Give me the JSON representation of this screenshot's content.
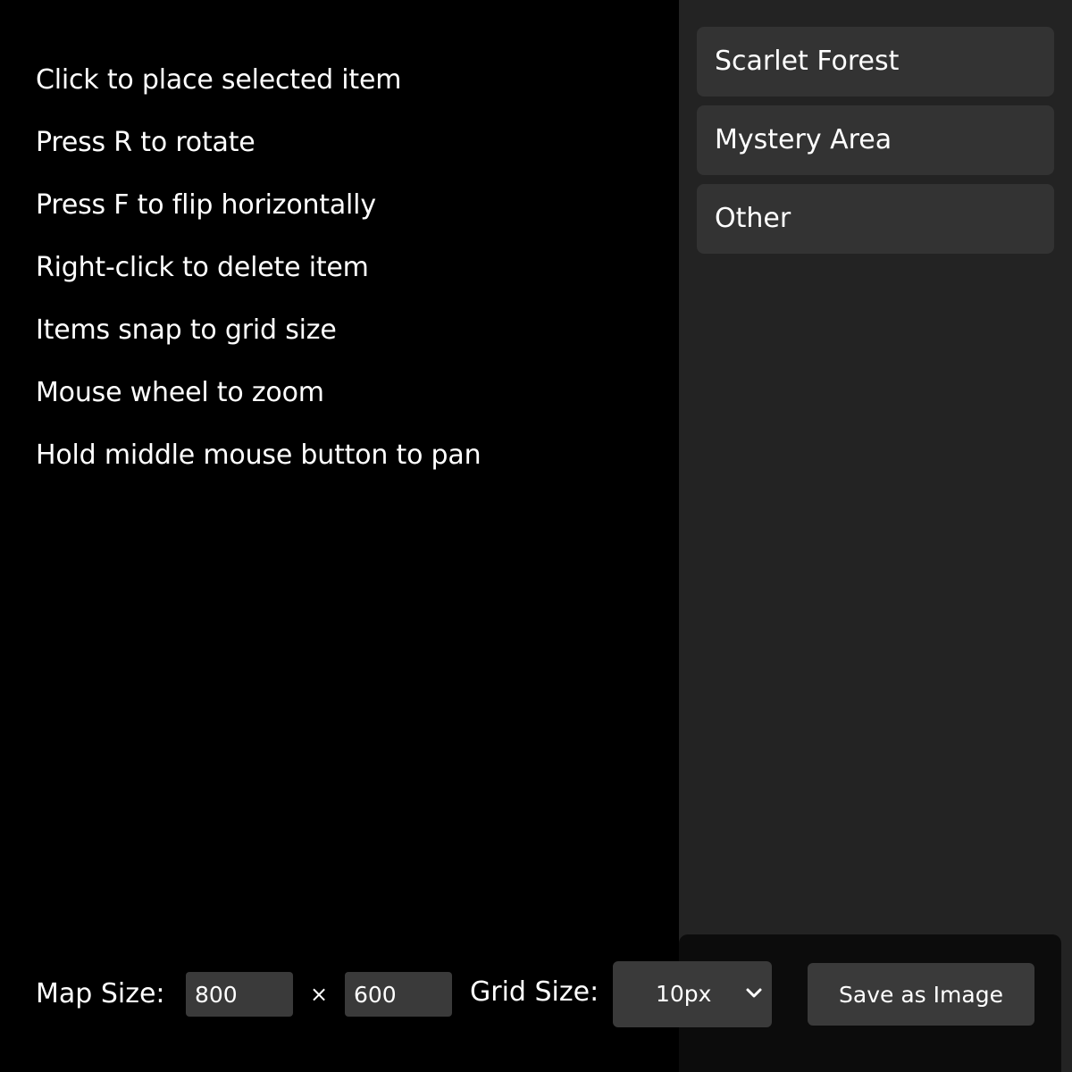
{
  "instructions": [
    "Click to place selected item",
    "Press R to rotate",
    "Press F to flip horizontally",
    "Right-click to delete item",
    "Items snap to grid size",
    "Mouse wheel to zoom",
    "Hold middle mouse button to pan"
  ],
  "sidebar": {
    "categories": [
      {
        "label": "Scarlet Forest"
      },
      {
        "label": "Mystery Area"
      },
      {
        "label": "Other"
      }
    ]
  },
  "toolbar": {
    "map_size_label": "Map Size:",
    "width_value": "800",
    "times_symbol": "×",
    "height_value": "600",
    "grid_size_label": "Grid Size:",
    "grid_size_value": "10px",
    "save_label": "Save as Image",
    "chevron_icon": "chevron-down-icon"
  },
  "colors": {
    "canvas_bg": "#000000",
    "sidebar_bg": "#232323",
    "item_bg": "#333333",
    "control_bg": "#3a3a3a",
    "text": "#ffffff"
  }
}
